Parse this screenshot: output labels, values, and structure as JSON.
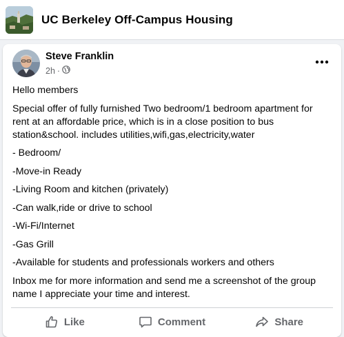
{
  "group": {
    "name": "UC Berkeley Off-Campus Housing",
    "thumbnail_icon": "group-photo-icon"
  },
  "post": {
    "author": "Steve Franklin",
    "time": "2h",
    "separator": "·",
    "audience_icon": "globe-icon",
    "more_icon": "more-options-icon",
    "lines": [
      "Hello members",
      "Special offer of fully furnished Two bedroom/1 bedroom apartment for rent at an affordable price, which is in a close position to bus station&school. includes utilities,wifi,gas,electricity,water",
      "- Bedroom/",
      "-Move-in Ready",
      "-Living Room and kitchen (privately)",
      "-Can walk,ride or drive to school",
      "-Wi-Fi/Internet",
      "-Gas Grill",
      "-Available for students and professionals workers and others",
      "Inbox me for more information and send me a screenshot of the group name I appreciate your time and interest."
    ]
  },
  "actions": {
    "like": "Like",
    "comment": "Comment",
    "share": "Share"
  },
  "colors": {
    "text": "#050505",
    "secondary_text": "#65676b",
    "background": "#f0f2f5",
    "card": "#ffffff"
  }
}
